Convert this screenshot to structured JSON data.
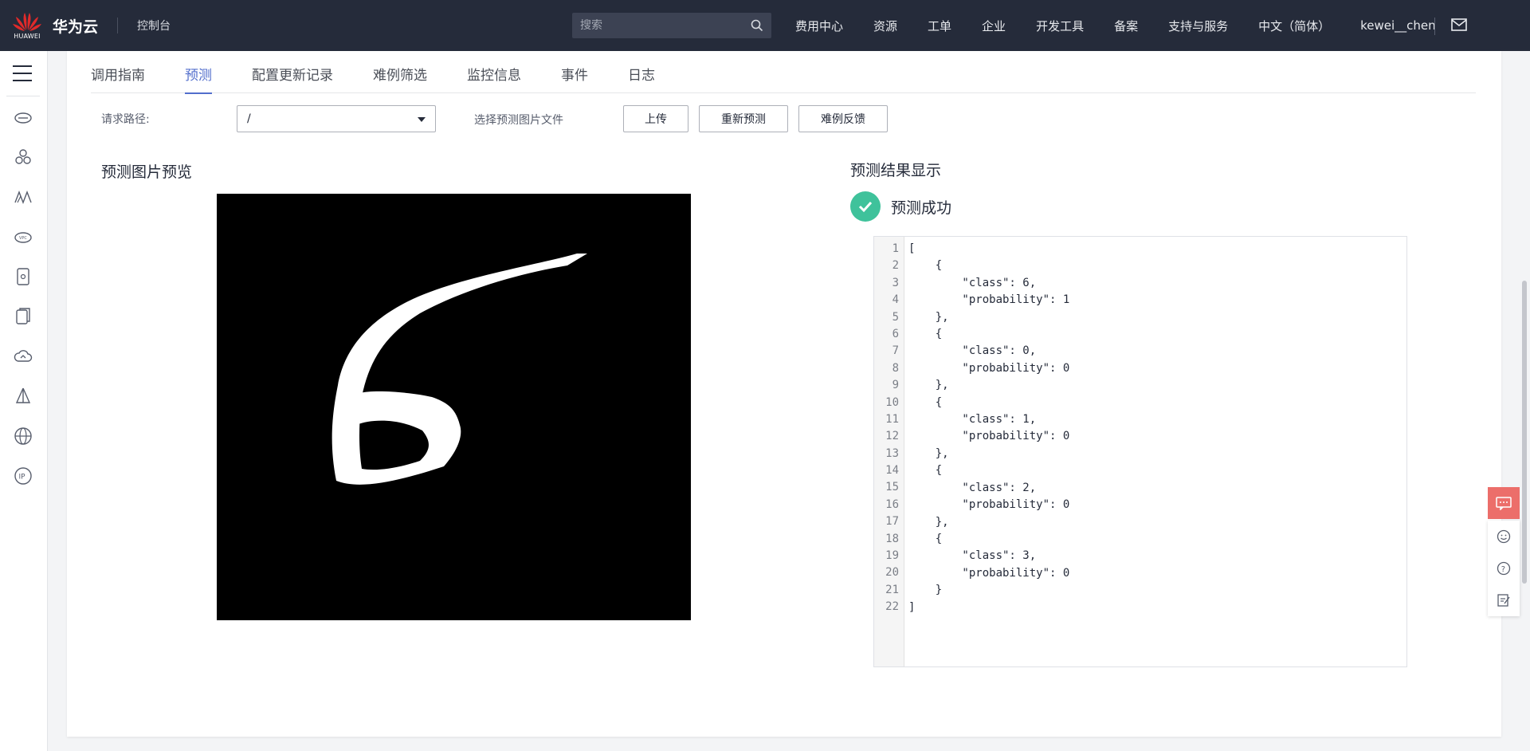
{
  "topbar": {
    "logo_text": "HUAWEI",
    "brand": "华为云",
    "console": "控制台",
    "search_placeholder": "搜索",
    "nav": [
      "费用中心",
      "资源",
      "工单",
      "企业",
      "开发工具",
      "备案",
      "支持与服务",
      "中文（简体）"
    ],
    "user": "kewei__chen",
    "mail_icon": "mail-icon"
  },
  "sidebar": {
    "icons": [
      "cloud-server-icon",
      "cluster-icon",
      "mountain-icon",
      "vpc-cloud-icon",
      "box-icon",
      "stack-icon",
      "cloud-arrow-icon",
      "tent-icon",
      "globe-icon",
      "ip-icon"
    ]
  },
  "tabs": [
    "调用指南",
    "预测",
    "配置更新记录",
    "难例筛选",
    "监控信息",
    "事件",
    "日志"
  ],
  "active_tab": "预测",
  "request": {
    "path_label": "请求路径:",
    "path_value": "/",
    "file_label": "选择预测图片文件",
    "upload": "上传",
    "repredict": "重新预测",
    "feedback": "难例反馈"
  },
  "preview": {
    "title": "预测图片预览"
  },
  "result": {
    "title": "预测结果显示",
    "status": "预测成功",
    "status_color": "#3fc29b",
    "line_numbers": [
      "1",
      "2",
      "3",
      "4",
      "5",
      "6",
      "7",
      "8",
      "9",
      "10",
      "11",
      "12",
      "13",
      "14",
      "15",
      "16",
      "17",
      "18",
      "19",
      "20",
      "21",
      "22"
    ],
    "code": "[\n    {\n        \"class\": 6,\n        \"probability\": 1\n    },\n    {\n        \"class\": 0,\n        \"probability\": 0\n    },\n    {\n        \"class\": 1,\n        \"probability\": 0\n    },\n    {\n        \"class\": 2,\n        \"probability\": 0\n    },\n    {\n        \"class\": 3,\n        \"probability\": 0\n    }\n]"
  },
  "float_tools": [
    "chat-icon",
    "smile-icon",
    "help-icon",
    "edit-icon"
  ],
  "colors": {
    "accent": "#526ecc",
    "topbar": "#252b3a",
    "float": "#ec6e6a"
  }
}
